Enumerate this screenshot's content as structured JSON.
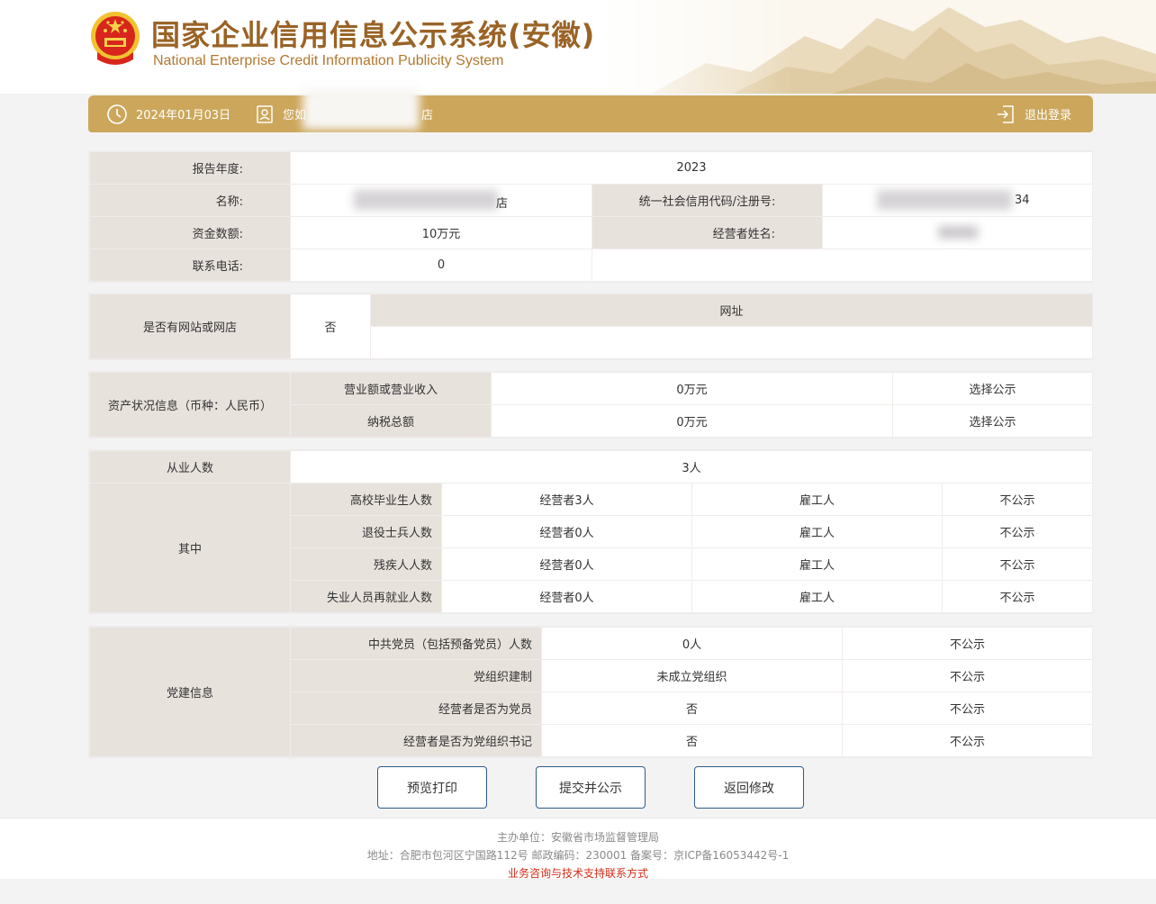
{
  "header": {
    "title_cn": "国家企业信用信息公示系统(安徽)",
    "title_en": "National Enterprise Credit Information Publicity System"
  },
  "topbar": {
    "date": "2024年01月03日",
    "greeting": "您如",
    "store_suffix": "店",
    "logout_label": "退出登录"
  },
  "basic": {
    "year_label": "报告年度:",
    "year_value": "2023",
    "name_label": "名称:",
    "name_suffix": "店",
    "credit_code_label": "统一社会信用代码/注册号:",
    "credit_code_suffix": "34",
    "capital_label": "资金数额:",
    "capital_value": "10万元",
    "operator_label": "经营者姓名:",
    "phone_label": "联系电话:",
    "phone_value": "0"
  },
  "website": {
    "label": "是否有网站或网店",
    "value": "否",
    "url_header": "网址"
  },
  "assets": {
    "label": "资产状况信息（币种：人民币）",
    "rows": [
      {
        "name": "营业额或营业收入",
        "value": "0万元",
        "publicity": "选择公示"
      },
      {
        "name": "纳税总额",
        "value": "0万元",
        "publicity": "选择公示"
      }
    ]
  },
  "employees": {
    "label": "从业人数",
    "value": "3人",
    "sub_label": "其中",
    "rows": [
      {
        "name": "高校毕业生人数",
        "operator": "经营者3人",
        "employee": "雇工人",
        "publicity": "不公示"
      },
      {
        "name": "退役士兵人数",
        "operator": "经营者0人",
        "employee": "雇工人",
        "publicity": "不公示"
      },
      {
        "name": "残疾人人数",
        "operator": "经营者0人",
        "employee": "雇工人",
        "publicity": "不公示"
      },
      {
        "name": "失业人员再就业人数",
        "operator": "经营者0人",
        "employee": "雇工人",
        "publicity": "不公示"
      }
    ]
  },
  "party": {
    "label": "党建信息",
    "rows": [
      {
        "name": "中共党员（包括预备党员）人数",
        "value": "0人",
        "publicity": "不公示"
      },
      {
        "name": "党组织建制",
        "value": "未成立党组织",
        "publicity": "不公示"
      },
      {
        "name": "经营者是否为党员",
        "value": "否",
        "publicity": "不公示"
      },
      {
        "name": "经营者是否为党组织书记",
        "value": "否",
        "publicity": "不公示"
      }
    ]
  },
  "buttons": {
    "preview": "预览打印",
    "submit": "提交并公示",
    "back": "返回修改"
  },
  "footer": {
    "host": "主办单位：安徽省市场监督管理局",
    "address": "地址：合肥市包河区宁国路112号 邮政编码：230001 备案号：京ICP备16053442号-1",
    "contact": "业务咨询与技术支持联系方式"
  },
  "colors": {
    "brand_gold": "#cca75b",
    "label_bg": "#e8e2dc",
    "title_brown": "#9a6326",
    "button_border": "#2f5b8a",
    "footer_red": "#d42b16"
  }
}
